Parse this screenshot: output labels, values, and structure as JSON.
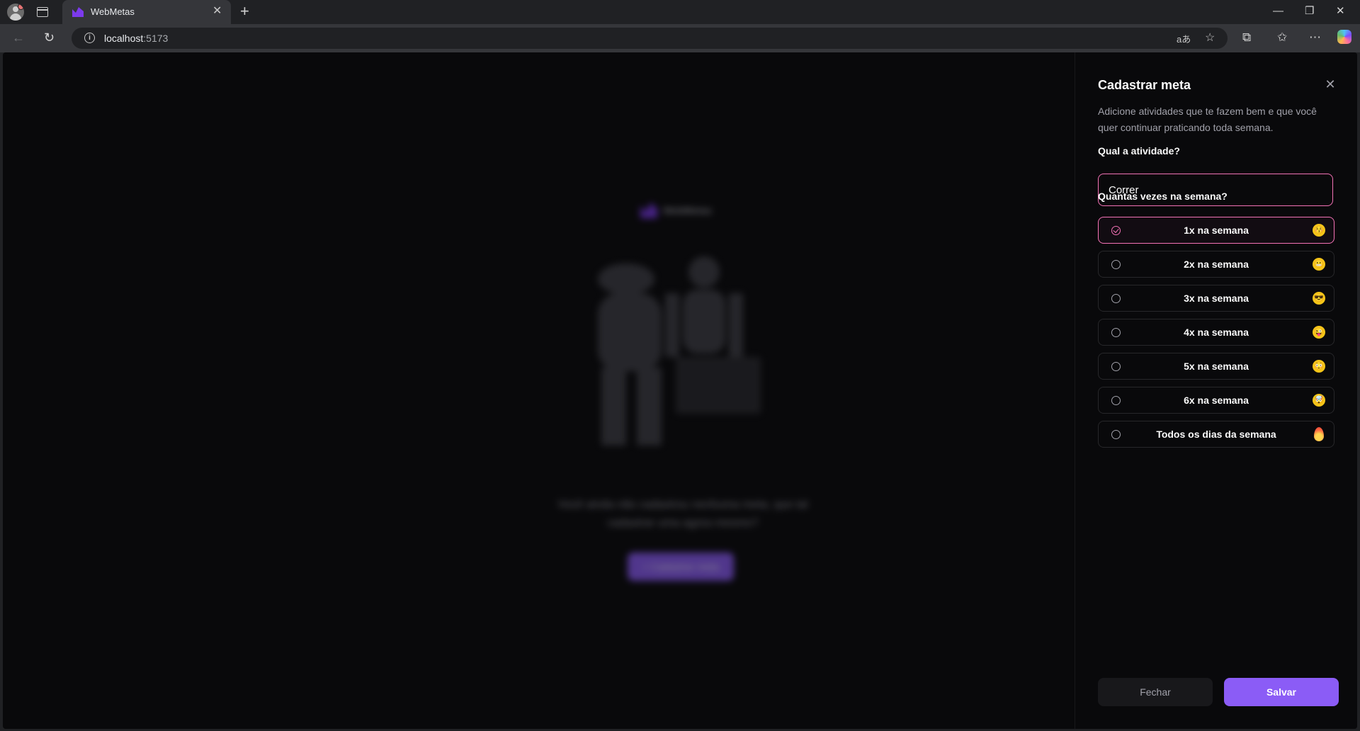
{
  "browser": {
    "tab_title": "WebMetas",
    "new_tab_symbol": "+",
    "url_host": "localhost",
    "url_port": ":5173",
    "accent": "#7c3aed"
  },
  "background_page": {
    "logo_text": "WebMetas",
    "message": "Você ainda não cadastrou nenhuma meta, que tal cadastrar uma agora mesmo?",
    "button_label": "+ Cadastrar meta"
  },
  "drawer": {
    "title": "Cadastrar meta",
    "description": "Adicione atividades que te fazem bem e que você quer continuar praticando toda semana.",
    "activity_label": "Qual a atividade?",
    "activity_value": "Correr",
    "frequency_label": "Quantas vezes na semana?",
    "options": [
      {
        "label": "1x na semana",
        "emoji": "kissing-face",
        "glyph": "😚",
        "selected": true
      },
      {
        "label": "2x na semana",
        "emoji": "grimacing-face",
        "glyph": "😬",
        "selected": false
      },
      {
        "label": "3x na semana",
        "emoji": "sunglasses-face",
        "glyph": "😎",
        "selected": false
      },
      {
        "label": "4x na semana",
        "emoji": "tongue-face",
        "glyph": "😜",
        "selected": false
      },
      {
        "label": "5x na semana",
        "emoji": "flushed-face",
        "glyph": "😳",
        "selected": false
      },
      {
        "label": "6x na semana",
        "emoji": "exploding-head",
        "glyph": "🤯",
        "selected": false
      },
      {
        "label": "Todos os dias da semana",
        "emoji": "fire",
        "glyph": "🔥",
        "selected": false
      }
    ],
    "close_button": "Fechar",
    "save_button": "Salvar",
    "selected_color": "#f472b6",
    "primary_color": "#8b5cf6"
  }
}
